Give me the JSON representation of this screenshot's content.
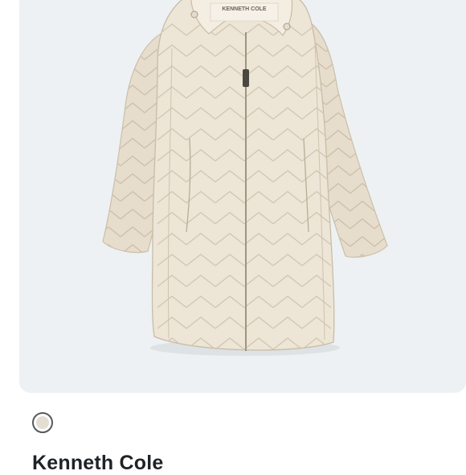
{
  "product": {
    "image_alt": "Cream quilted long puffer coat with hood",
    "label_text": "KENNETH COLE",
    "brand": "Kenneth Cole",
    "swatch_color": "#e3ddd2"
  },
  "colors": {
    "card_background": "#edf1f3",
    "coat_fill": "#ebe3d4",
    "coat_quilt": "#cfc4b0",
    "text": "#1f2326"
  }
}
